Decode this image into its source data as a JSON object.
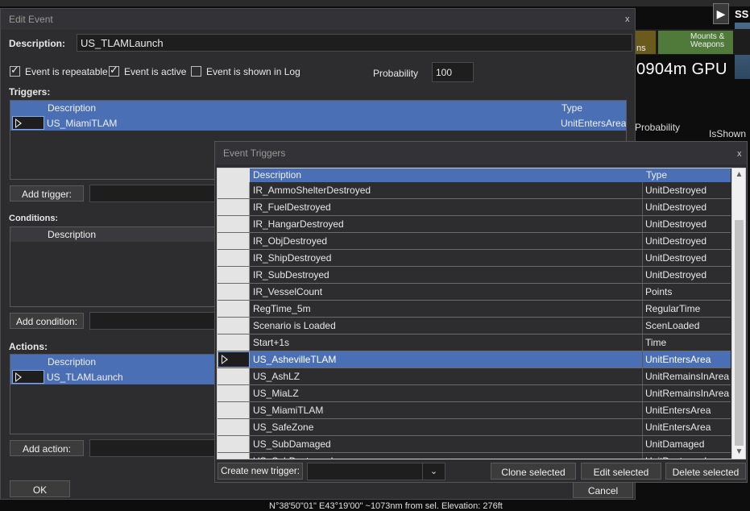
{
  "background": {
    "tile_a_label": "ns",
    "tile_b_label": "Mounts & Weapons",
    "readout": "0904m  GPU",
    "col_probability": "Probability",
    "col_isshown": "IsShown",
    "side_label": "SS",
    "play_symbol": "▶",
    "coords_text": "N°38'50\"01\"  E43°19'00\"  ~1073nm from sel.   Elevation: 276ft"
  },
  "edit_event": {
    "title": "Edit Event",
    "close": "x",
    "description_label": "Description:",
    "description_value": "US_TLAMLaunch",
    "repeatable_label": "Event is repeatable",
    "repeatable_checked": true,
    "active_label": "Event is active",
    "active_checked": true,
    "shown_label": "Event is shown in Log",
    "shown_checked": false,
    "probability_label": "Probability",
    "probability_value": "100",
    "triggers_label": "Triggers:",
    "triggers_columns": [
      "Description",
      "Type"
    ],
    "triggers_rows": [
      {
        "description": "US_MiamiTLAM",
        "type": "UnitEntersArea"
      }
    ],
    "add_trigger": "Add trigger:",
    "conditions_label": "Conditions:",
    "conditions_columns": [
      "Description"
    ],
    "add_condition": "Add condition:",
    "actions_label": "Actions:",
    "actions_columns": [
      "Description"
    ],
    "actions_rows": [
      {
        "description": "US_TLAMLaunch"
      }
    ],
    "add_action": "Add action:",
    "ok": "OK",
    "cancel": "Cancel"
  },
  "event_triggers": {
    "title": "Event Triggers",
    "close": "x",
    "columns": [
      "Description",
      "Type"
    ],
    "rows": [
      {
        "description": "IR_AmmoShelterDestroyed",
        "type": "UnitDestroyed"
      },
      {
        "description": "IR_FuelDestroyed",
        "type": "UnitDestroyed"
      },
      {
        "description": "IR_HangarDestroyed",
        "type": "UnitDestroyed"
      },
      {
        "description": "IR_ObjDestroyed",
        "type": "UnitDestroyed"
      },
      {
        "description": "IR_ShipDestroyed",
        "type": "UnitDestroyed"
      },
      {
        "description": "IR_SubDestroyed",
        "type": "UnitDestroyed"
      },
      {
        "description": "IR_VesselCount",
        "type": "Points"
      },
      {
        "description": "RegTime_5m",
        "type": "RegularTime"
      },
      {
        "description": "Scenario is Loaded",
        "type": "ScenLoaded"
      },
      {
        "description": "Start+1s",
        "type": "Time"
      },
      {
        "description": "US_AshevilleTLAM",
        "type": "UnitEntersArea"
      },
      {
        "description": "US_AshLZ",
        "type": "UnitRemainsInArea"
      },
      {
        "description": "US_MiaLZ",
        "type": "UnitRemainsInArea"
      },
      {
        "description": "US_MiamiTLAM",
        "type": "UnitEntersArea"
      },
      {
        "description": "US_SafeZone",
        "type": "UnitEntersArea"
      },
      {
        "description": "US_SubDamaged",
        "type": "UnitDamaged"
      },
      {
        "description": "US_SubDestroyed",
        "type": "UnitDestroyed"
      }
    ],
    "selected_row": "US_AshevilleTLAM",
    "create_label": "Create new trigger:",
    "dropdown_value": "",
    "clone": "Clone selected",
    "edit": "Edit selected",
    "delete": "Delete selected"
  }
}
